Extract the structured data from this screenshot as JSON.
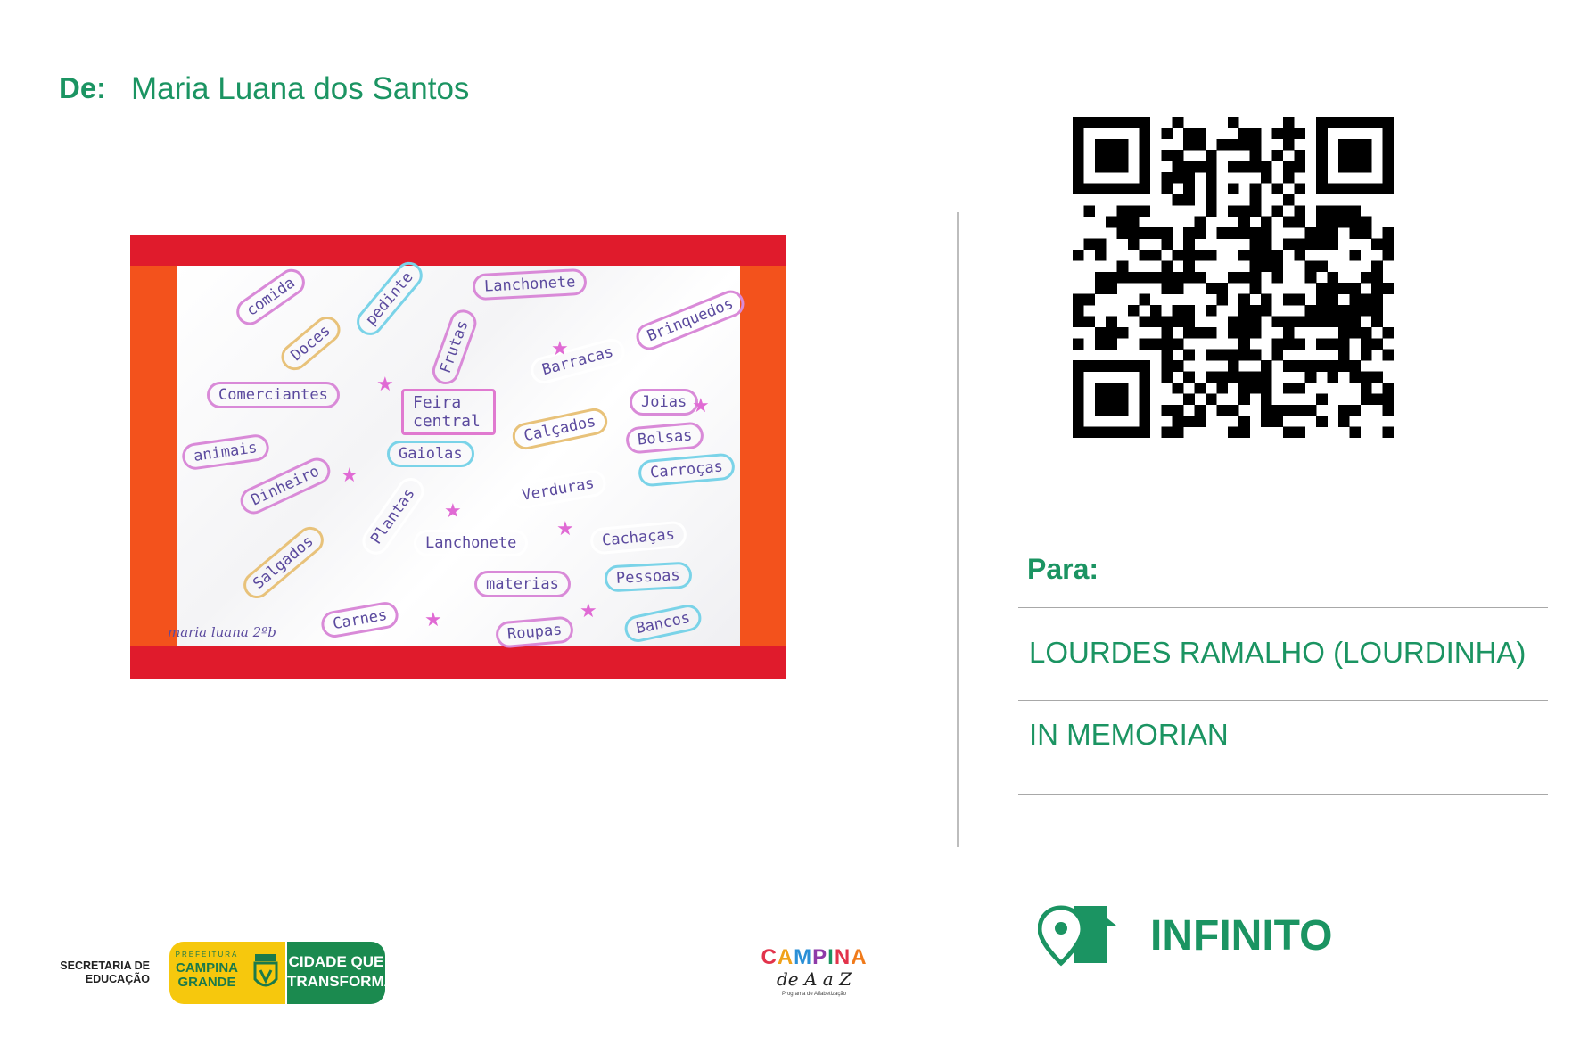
{
  "header": {
    "from_label": "De:",
    "from_name": "Maria Luana dos Santos"
  },
  "drawing": {
    "words": [
      "comida",
      "pedinte",
      "Lanchonete",
      "Brinquedos",
      "Doces",
      "Frutas",
      "Barracas",
      "Comerciantes",
      "Feira central",
      "Joias",
      "Calçados",
      "Bolsas",
      "animais",
      "Gaiolas",
      "Carroças",
      "Dinheiro",
      "Verduras",
      "Plantas",
      "Lanchonete",
      "Cachaças",
      "Salgados",
      "materias",
      "Pessoas",
      "Carnes",
      "Roupas",
      "Bancos"
    ],
    "signature": "maria luana 2ºb"
  },
  "recipient": {
    "to_label": "Para:",
    "line1": "LOURDES RAMALHO (LOURDINHA)",
    "line2": "IN MEMORIAN"
  },
  "brand": {
    "infinito": "INFINITO",
    "icon": "home-location-icon"
  },
  "logos": {
    "secretaria": "SECRETARIA DE EDUCAÇÃO",
    "prefeitura_small": "PREFEITURA",
    "prefeitura_big": "CAMPINA GRANDE",
    "cidade": "CIDADE QUE TRANSFORMA",
    "campina_title": "CAMPINA",
    "campina_sub": "de A a Z",
    "campina_tiny": "Programa de Alfabetização"
  },
  "colors": {
    "green": "#1b9462",
    "red_border": "#e01b2c",
    "orange": "#f3521c",
    "yellow": "#f6c80d"
  }
}
